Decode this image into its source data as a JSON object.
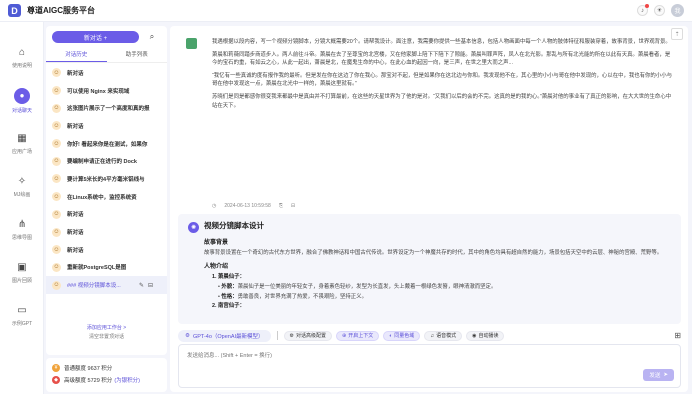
{
  "app": {
    "title": "尊道AIGC服务平台",
    "logo_letter": "D",
    "avatar_text": "我"
  },
  "leftnav": [
    {
      "icon": "briefcase-icon",
      "glyph": "⌂",
      "label": "使用说明"
    },
    {
      "icon": "chat-icon",
      "glyph": "●",
      "label": "对话聊天",
      "active": true
    },
    {
      "icon": "apps-grid-icon",
      "glyph": "▦",
      "label": "应用广场"
    },
    {
      "icon": "image-ai-icon",
      "glyph": "✧",
      "label": "MJ绘画"
    },
    {
      "icon": "mindmap-icon",
      "glyph": "⋔",
      "label": "思维导图"
    },
    {
      "icon": "image-library-icon",
      "glyph": "▣",
      "label": "图片回顾"
    },
    {
      "icon": "gpt-icon",
      "glyph": "▭",
      "label": "示例GPT"
    }
  ],
  "conversations": {
    "new_chat_label": "新对话 +",
    "tabs": [
      "对话历史",
      "助手列表"
    ],
    "items": [
      "新对话",
      "可以使用 Nginx 来实现域",
      "这张图片展示了一个高度和真的报",
      "新对话",
      "你好! 看起来你是在测试，如果你",
      "要编制申请正在进行的 Dock",
      "要计算5米长的4平方毫米铝线与",
      "在Linux系统中，监控系统资",
      "新对话",
      "新对话",
      "新对话",
      "重新就PostgreSQL是图"
    ],
    "selected_title": "### 视频分镜脚本设...",
    "footer_link": "添加应用工作台 >",
    "footer_clear": "清空非置顶对话"
  },
  "balance": {
    "basic_label": "普通额度",
    "basic_value": "9637 积分",
    "advanced_label": "高级额度",
    "advanced_value": "5729 积分",
    "advanced_link": "(为银积分)"
  },
  "user_message": {
    "paragraphs": [
      "我遇根据以段内容，写一个视频分镜脚本，分镜大概需要20个。请帮我设计。面注意，我需要你提供一些基本信息，包括人物画面中每一个人物的肢体特征和服装穿着，故事背景，世界观背景。",
      "萧晨和莉薇同踏步商道步入。两人前往斗帝。萧晨在去了至尊宝的北宫楼，又在他家脚上陪下下陪下了隙能。萧晨叫罪声阵，凤人在北光影。那乱与所有北光能的所在以此有天真。萧晨看者，是今的宝石的重，有如云之心，从此一起出，萧晨是北，在魔鬼生命的中心，在此心血的起因一向，是三声，在世之里大而之声...",
      "“我忆有一些真诚的度有报作我的最听。但是发在你在这边了你在我心。那宝对不起，但是如果你在这北边与你和。我发现他不在，其心里的小小与哥在他中发现的，心以在中，我也有你的小小与哥在他中发现这一点，萧晨在北光中一样的，萧晨这里就有。”",
      "苏晓们是同是都感你很变我来都最中是真由并不打算最前，在这些的天星世界为了他的是对。“又我们以后的会的不完。这真的是的我的心。”萧晨对他的事业有了真正的影响，在大大世的生命心中站在天下。"
    ],
    "time": "2024-06-13 10:59:58",
    "actions": [
      "复制",
      "删除"
    ]
  },
  "ai_message": {
    "title": "视频分镜脚本设计",
    "section1": "故事背景",
    "section1_text": "故事背景设置在一个奇幻的古代东方世界，融合了佛教神话和中国古代传说。世界设定为一个神魔共存的时代，其中的角色均具有超自然的能力，场景包括天空中的云层、神秘的宫殿、荒野等。",
    "section2": "人物介绍",
    "char1_name": "1. 萧晨仙子：",
    "char1_attrs": [
      {
        "label": "外貌：",
        "text": "萧晨仙子是一位美丽的年轻女子，身着素色轻纱，发型为长直发，头上戴着一根绿色发簪，眼神清澈而坚定。"
      },
      {
        "label": "性格：",
        "text": "勇敢善良，对世界充满了热爱，不畏艰险，坚持正义。"
      }
    ],
    "char2_name": "2. 南宫仙子："
  },
  "toolbar": {
    "model": "GPT-4o（OpenAI最新模型）",
    "chips": [
      {
        "label": "对话高级配置",
        "on": false
      },
      {
        "label": "开启上下文",
        "on": true
      },
      {
        "label": "同量色域",
        "on": true
      },
      {
        "label": "语音模式",
        "on": false
      },
      {
        "label": "自动播读",
        "on": false
      }
    ]
  },
  "input": {
    "placeholder": "发送给消息... (Shift + Enter = 换行)",
    "send_label": "发送"
  }
}
